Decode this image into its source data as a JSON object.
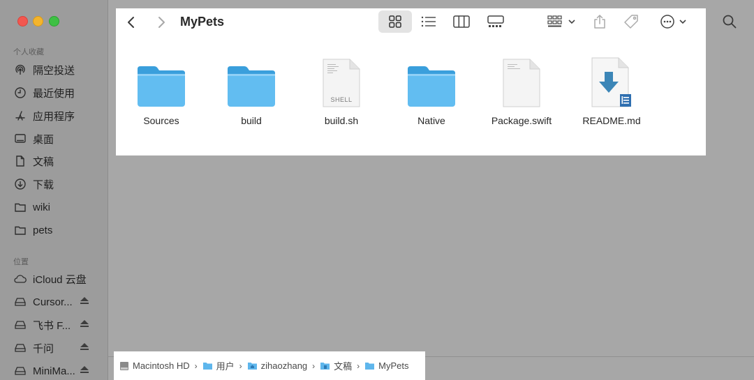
{
  "sidebar": {
    "section_favorites": "个人收藏",
    "favorites": [
      {
        "label": "隔空投送",
        "icon": "airdrop-icon"
      },
      {
        "label": "最近使用",
        "icon": "clock-icon"
      },
      {
        "label": "应用程序",
        "icon": "applications-icon"
      },
      {
        "label": "桌面",
        "icon": "desktop-icon"
      },
      {
        "label": "文稿",
        "icon": "document-icon"
      },
      {
        "label": "下载",
        "icon": "download-icon"
      },
      {
        "label": "wiki",
        "icon": "folder-icon"
      },
      {
        "label": "pets",
        "icon": "folder-icon"
      }
    ],
    "section_locations": "位置",
    "locations": [
      {
        "label": "iCloud 云盘",
        "icon": "cloud-icon"
      },
      {
        "label": "Cursor...",
        "icon": "drive-icon"
      },
      {
        "label": "飞书 F...",
        "icon": "drive-icon"
      },
      {
        "label": "千问",
        "icon": "drive-icon"
      },
      {
        "label": "MiniMa...",
        "icon": "drive-icon"
      }
    ]
  },
  "window": {
    "title": "MyPets",
    "files": [
      {
        "name": "Sources",
        "kind": "folder"
      },
      {
        "name": "build",
        "kind": "folder"
      },
      {
        "name": "build.sh",
        "kind": "shell",
        "badge": "SHELL"
      },
      {
        "name": "Native",
        "kind": "folder"
      },
      {
        "name": "Package.swift",
        "kind": "document"
      },
      {
        "name": "README.md",
        "kind": "markdown"
      }
    ]
  },
  "pathbar": {
    "items": [
      "Macintosh HD",
      "用户",
      "zihaozhang",
      "文稿",
      "MyPets"
    ],
    "separator": "›"
  },
  "colors": {
    "folder_top": "#3aa0dc",
    "folder_body": "#5fbaf0",
    "accent": "#2f7fc0"
  }
}
